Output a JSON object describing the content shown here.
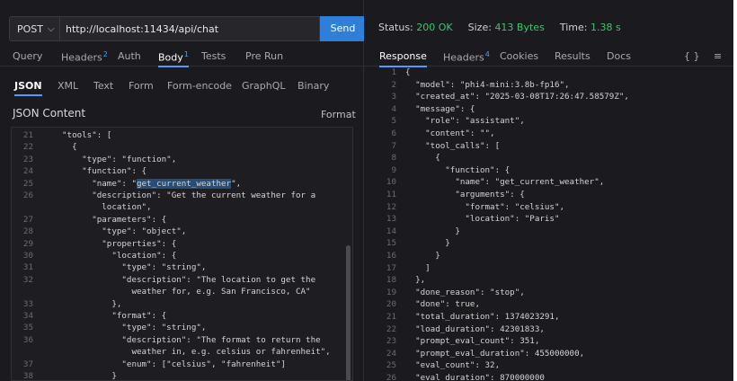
{
  "request": {
    "method": "POST",
    "url": "http://localhost:11434/api/chat",
    "send_label": "Send"
  },
  "request_tabs": [
    {
      "label": "Query",
      "badge": ""
    },
    {
      "label": "Headers",
      "badge": "2"
    },
    {
      "label": "Auth",
      "badge": ""
    },
    {
      "label": "Body",
      "badge": "1"
    },
    {
      "label": "Tests",
      "badge": ""
    },
    {
      "label": "Pre Run",
      "badge": ""
    }
  ],
  "body_tabs": [
    "JSON",
    "XML",
    "Text",
    "Form",
    "Form-encode",
    "GraphQL",
    "Binary"
  ],
  "editor": {
    "title": "JSON Content",
    "format_label": "Format",
    "lines": [
      {
        "n": "21",
        "text": "\"tools\": ["
      },
      {
        "n": "22",
        "text": "  {"
      },
      {
        "n": "23",
        "text": "    \"type\": \"function\","
      },
      {
        "n": "24",
        "text": "    \"function\": {"
      },
      {
        "n": "25",
        "text": "      \"name\": \"get_current_weather\","
      },
      {
        "n": "26",
        "text": "      \"description\": \"Get the current weather for a"
      },
      {
        "n": "",
        "text": "        location\","
      },
      {
        "n": "27",
        "text": "      \"parameters\": {"
      },
      {
        "n": "28",
        "text": "        \"type\": \"object\","
      },
      {
        "n": "29",
        "text": "        \"properties\": {"
      },
      {
        "n": "30",
        "text": "          \"location\": {"
      },
      {
        "n": "31",
        "text": "            \"type\": \"string\","
      },
      {
        "n": "32",
        "text": "            \"description\": \"The location to get the"
      },
      {
        "n": "",
        "text": "              weather for, e.g. San Francisco, CA\""
      },
      {
        "n": "33",
        "text": "          },"
      },
      {
        "n": "34",
        "text": "          \"format\": {"
      },
      {
        "n": "35",
        "text": "            \"type\": \"string\","
      },
      {
        "n": "36",
        "text": "            \"description\": \"The format to return the"
      },
      {
        "n": "",
        "text": "              weather in, e.g. celsius or fahrenheit\","
      },
      {
        "n": "37",
        "text": "            \"enum\": [\"celsius\", \"fahrenheit\"]"
      },
      {
        "n": "38",
        "text": "          }"
      }
    ]
  },
  "status": {
    "status_label": "Status:",
    "status_value": "200 OK",
    "size_label": "Size:",
    "size_value": "413 Bytes",
    "time_label": "Time:",
    "time_value": "1.38 s"
  },
  "response_tabs": [
    {
      "label": "Response",
      "badge": ""
    },
    {
      "label": "Headers",
      "badge": "4"
    },
    {
      "label": "Cookies",
      "badge": ""
    },
    {
      "label": "Results",
      "badge": ""
    },
    {
      "label": "Docs",
      "badge": ""
    }
  ],
  "response_icons": {
    "braces": "{ }",
    "menu": "≡"
  },
  "response": {
    "lines": [
      {
        "n": "1",
        "text": "{"
      },
      {
        "n": "2",
        "text": "  \"model\": \"phi4-mini:3.8b-fp16\","
      },
      {
        "n": "3",
        "text": "  \"created_at\": \"2025-03-08T17:26:47.58579Z\","
      },
      {
        "n": "4",
        "text": "  \"message\": {"
      },
      {
        "n": "5",
        "text": "    \"role\": \"assistant\","
      },
      {
        "n": "6",
        "text": "    \"content\": \"\","
      },
      {
        "n": "7",
        "text": "    \"tool_calls\": ["
      },
      {
        "n": "8",
        "text": "      {"
      },
      {
        "n": "9",
        "text": "        \"function\": {"
      },
      {
        "n": "10",
        "text": "          \"name\": \"get_current_weather\","
      },
      {
        "n": "11",
        "text": "          \"arguments\": {"
      },
      {
        "n": "12",
        "text": "            \"format\": \"celsius\","
      },
      {
        "n": "13",
        "text": "            \"location\": \"Paris\""
      },
      {
        "n": "14",
        "text": "          }"
      },
      {
        "n": "15",
        "text": "        }"
      },
      {
        "n": "16",
        "text": "      }"
      },
      {
        "n": "17",
        "text": "    ]"
      },
      {
        "n": "18",
        "text": "  },"
      },
      {
        "n": "19",
        "text": "  \"done_reason\": \"stop\","
      },
      {
        "n": "20",
        "text": "  \"done\": true,"
      },
      {
        "n": "21",
        "text": "  \"total_duration\": 1374023291,"
      },
      {
        "n": "22",
        "text": "  \"load_duration\": 42301833,"
      },
      {
        "n": "23",
        "text": "  \"prompt_eval_count\": 351,"
      },
      {
        "n": "24",
        "text": "  \"prompt_eval_duration\": 455000000,"
      },
      {
        "n": "25",
        "text": "  \"eval_count\": 32,"
      },
      {
        "n": "26",
        "text": "  \"eval_duration\": 870000000"
      }
    ]
  }
}
